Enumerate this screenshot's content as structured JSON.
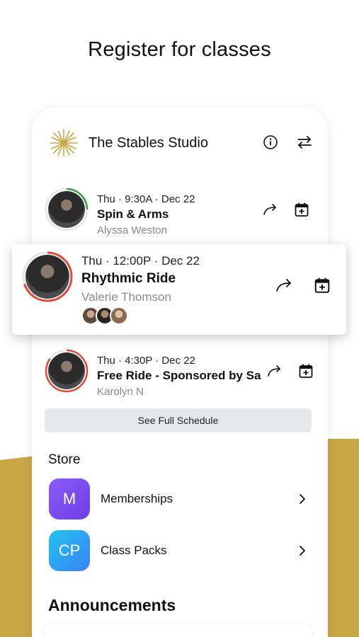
{
  "headline": "Register for classes",
  "studio": {
    "name": "The Stables Studio",
    "logo_icon": "starburst-logo",
    "info_icon": "info-icon",
    "switch_icon": "swap-arrows-icon"
  },
  "classes": [
    {
      "time": "Thu · 9:30A · Dec 22",
      "title": "Spin & Arms",
      "instructor": "Alyssa Weston",
      "progress_color": "#2E9E3E",
      "progress_fraction": 0.25
    },
    {
      "time": "Thu · 12:00P · Dec 22",
      "title": "Rhythmic Ride",
      "instructor": "Valerie Thomson",
      "progress_color": "#E04A3A",
      "progress_fraction": 0.7
    },
    {
      "time": "Thu · 4:30P · Dec 22",
      "title": "Free Ride - Sponsored by Sa",
      "instructor": "Karolyn  N",
      "progress_color": "#E04A3A",
      "progress_fraction": 0.85
    }
  ],
  "see_full_schedule": "See Full Schedule",
  "store": {
    "title": "Store",
    "items": [
      {
        "badge": "M",
        "label": "Memberships",
        "color_from": "#8B5CF6",
        "color_to": "#6D3FE6"
      },
      {
        "badge": "CP",
        "label": "Class Packs",
        "color_from": "#22C3EE",
        "color_to": "#3B82F6"
      }
    ]
  },
  "announcements_title": "Announcements",
  "colors": {
    "gold": "#C9A646"
  }
}
